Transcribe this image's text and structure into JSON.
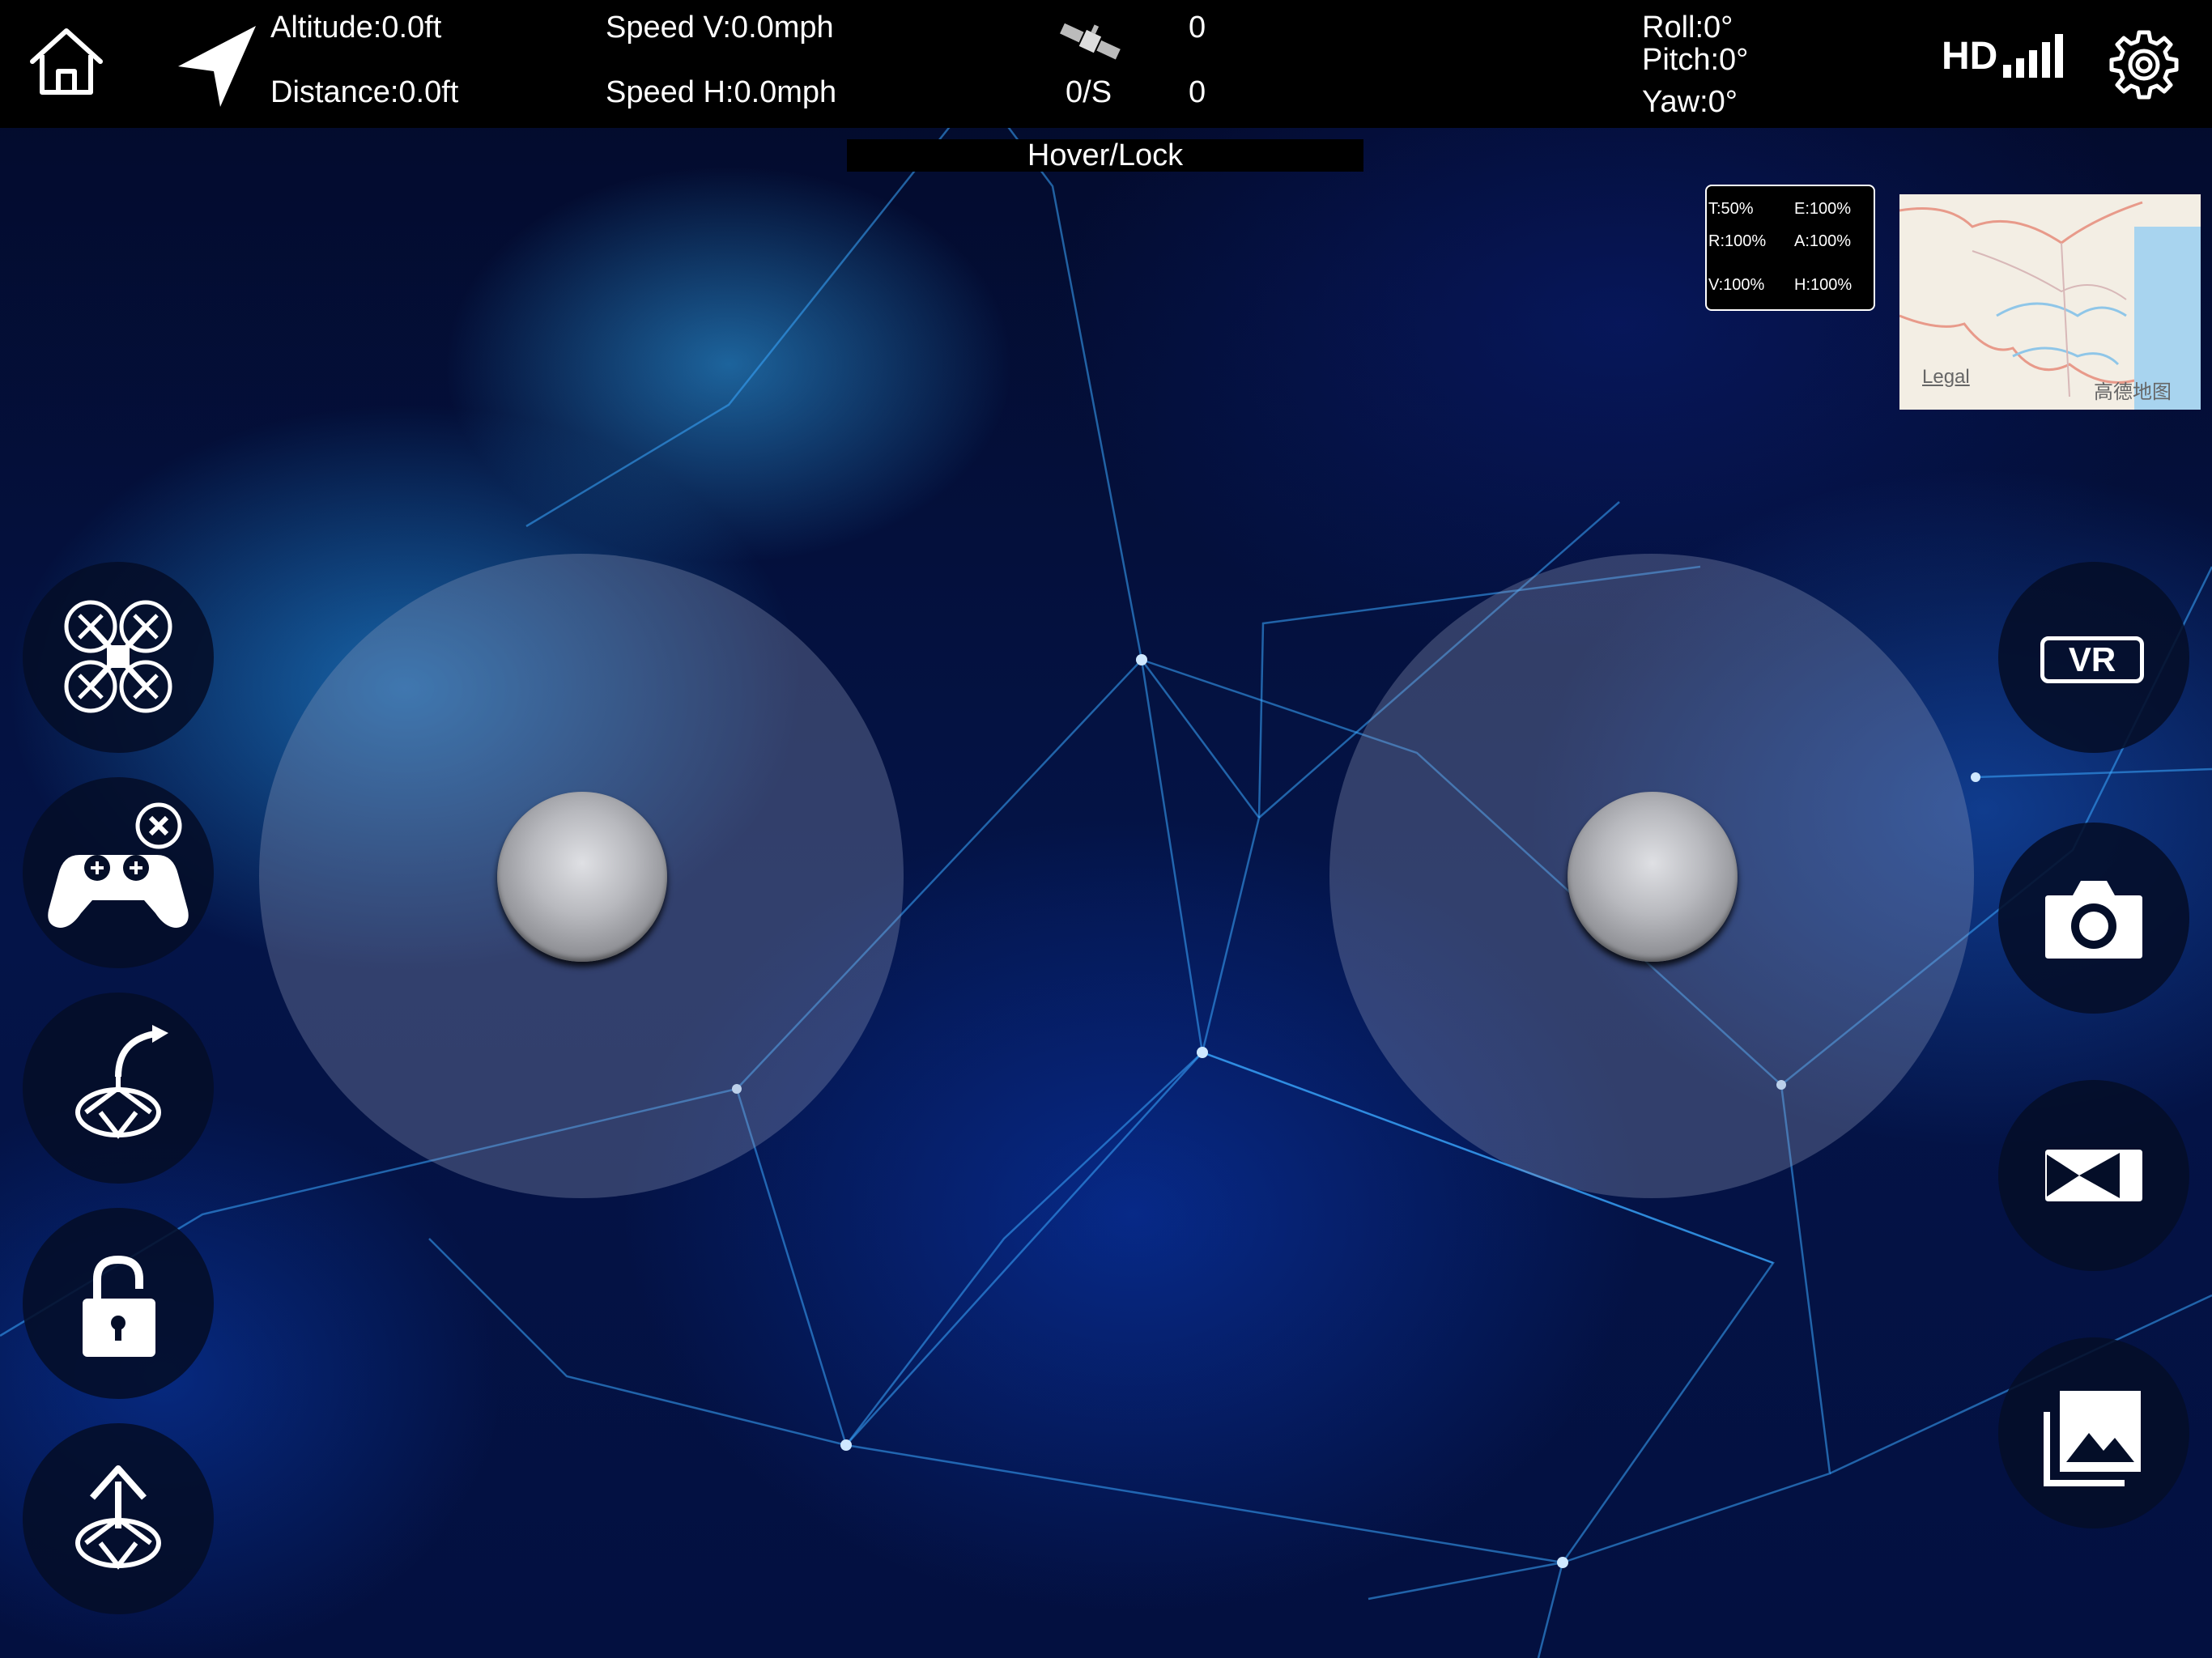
{
  "telemetry": {
    "altitude": "Altitude:0.0ft",
    "distance": "Distance:0.0ft",
    "speed_v": "Speed V:0.0mph",
    "speed_h": "Speed H:0.0mph",
    "satellite_count": "0",
    "satellite_rate": "0/S",
    "satellite_value": "0",
    "roll": "Roll:0°",
    "pitch": "Pitch:0°",
    "yaw": "Yaw:0°"
  },
  "topbar": {
    "hd_label": "HD",
    "icons": [
      "home-icon",
      "navigation-arrow-icon",
      "satellite-icon",
      "signal-bars-icon",
      "gear-icon"
    ]
  },
  "flight_mode": "Hover/Lock",
  "trim": {
    "t": "T:50%",
    "e": "E:100%",
    "r": "R:100%",
    "a": "A:100%",
    "v": "V:100%",
    "h": "H:100%"
  },
  "map": {
    "legal": "Legal",
    "provider": "高德地图"
  },
  "left_buttons": [
    "drone-icon",
    "gamepad-off-icon",
    "return-home-icon",
    "lock-open-icon",
    "takeoff-icon"
  ],
  "right_buttons": {
    "vr_label": "VR",
    "icons": [
      "vr-icon",
      "camera-icon",
      "video-record-icon",
      "gallery-icon"
    ]
  },
  "colors": {
    "topbar": "#000000",
    "button_bg": "#040e28",
    "background_dark": "#031040",
    "mesh_line": "#3aa8ff"
  }
}
